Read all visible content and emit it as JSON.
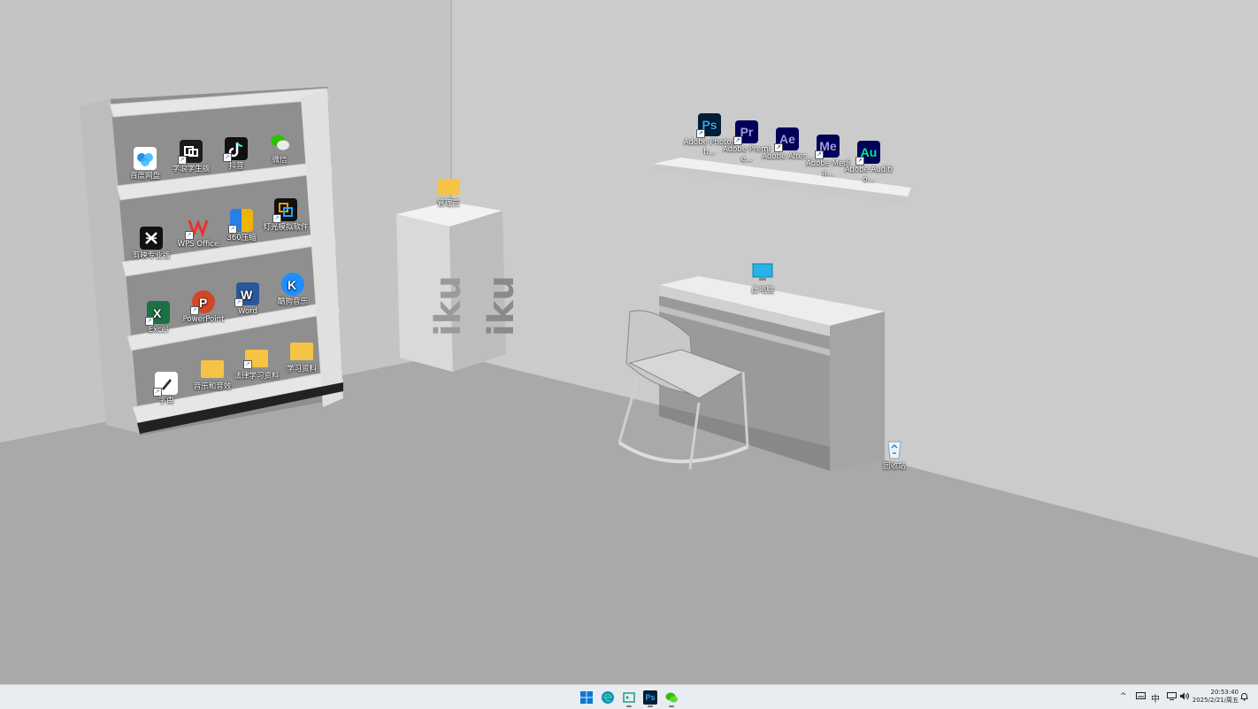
{
  "desktop": {
    "icons": [
      {
        "name": "baidu-netdisk",
        "label": "百度网盘"
      },
      {
        "name": "xuelang-student",
        "label": "学浪学生版"
      },
      {
        "name": "douyin",
        "label": "抖音"
      },
      {
        "name": "wechat",
        "label": "微信"
      },
      {
        "name": "jianying-pro",
        "label": "剪映专业版"
      },
      {
        "name": "wps-office",
        "label": "WPS Office"
      },
      {
        "name": "360-zip",
        "label": "360压缩"
      },
      {
        "name": "dengguang-emulator",
        "label": "灯光模拟软件"
      },
      {
        "name": "excel",
        "label": "Excel"
      },
      {
        "name": "powerpoint",
        "label": "PowerPoint"
      },
      {
        "name": "word",
        "label": "Word"
      },
      {
        "name": "kugou-music",
        "label": "酷狗音乐"
      },
      {
        "name": "ziyou",
        "label": "字由"
      },
      {
        "name": "music-sfx-folder",
        "label": "音乐和音效"
      },
      {
        "name": "law-materials-folder",
        "label": "法律学习资料"
      },
      {
        "name": "study-materials-folder",
        "label": "学习资料"
      },
      {
        "name": "folder-on-pedestal",
        "label": "管理员"
      },
      {
        "name": "photoshop",
        "label": "Adobe Photosh...",
        "abbr": "Ps"
      },
      {
        "name": "premiere",
        "label": "Adobe Premie...",
        "abbr": "Pr"
      },
      {
        "name": "after-effects",
        "label": "Adobe After...",
        "abbr": "Ae"
      },
      {
        "name": "media-encoder",
        "label": "Adobe Media...",
        "abbr": "Me"
      },
      {
        "name": "audition",
        "label": "Adobe Auditio...",
        "abbr": "Au"
      },
      {
        "name": "this-pc",
        "label": "此电脑"
      },
      {
        "name": "recycle-bin",
        "label": "回收站"
      }
    ]
  },
  "taskbar": {
    "apps": [
      "start-icon",
      "edge-icon",
      "snipping-tool-icon",
      "photoshop-icon",
      "wechat-icon"
    ],
    "tray": {
      "ime": "中"
    },
    "clock": {
      "time": "20:53:40",
      "date": "2025/2/21/周五"
    }
  },
  "colors": {
    "taskbar": "#e9ecf0",
    "adobe_bg": "#001e36",
    "ps": "#31a8ff",
    "pr": "#9999ff",
    "ae": "#9999ff",
    "me": "#9999ff",
    "au": "#00e4bb"
  }
}
